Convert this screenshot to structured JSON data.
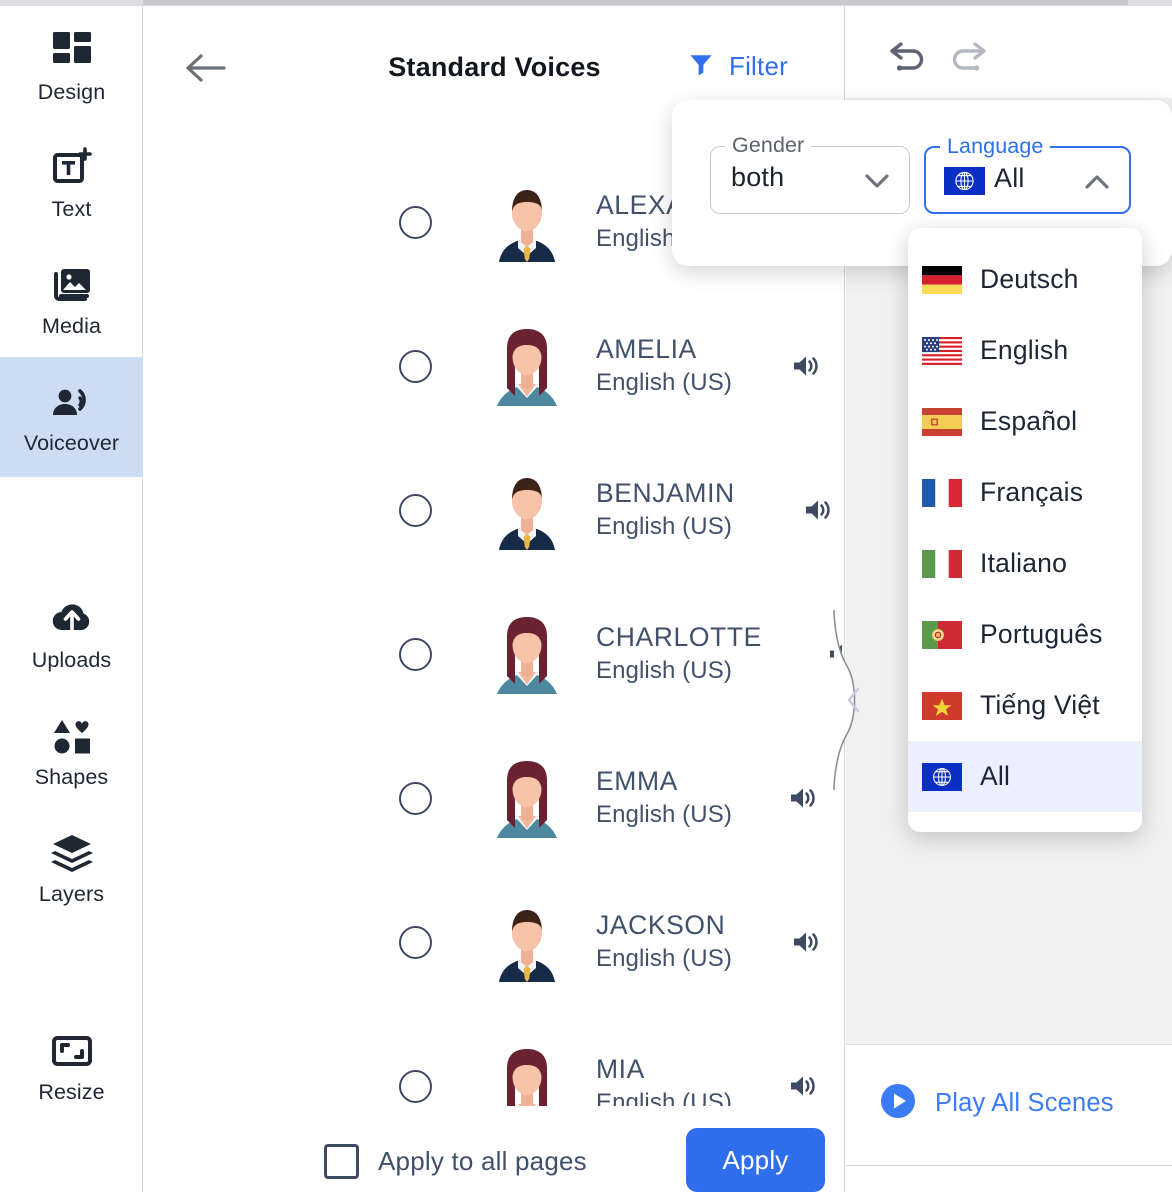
{
  "sidebar": {
    "items": [
      {
        "label": "Design",
        "icon": "grid-icon",
        "active": false
      },
      {
        "label": "Text",
        "icon": "text-add-icon",
        "active": false
      },
      {
        "label": "Media",
        "icon": "media-icon",
        "active": false
      },
      {
        "label": "Voiceover",
        "icon": "voiceover-icon",
        "active": true
      },
      {
        "label": "Uploads",
        "icon": "cloud-upload-icon",
        "active": false
      },
      {
        "label": "Shapes",
        "icon": "shapes-icon",
        "active": false
      },
      {
        "label": "Layers",
        "icon": "layers-icon",
        "active": false
      },
      {
        "label": "Resize",
        "icon": "resize-icon",
        "active": false
      }
    ]
  },
  "panel": {
    "title": "Standard Voices",
    "back_icon": "back-arrow-icon",
    "filter_label": "Filter",
    "filter_icon": "funnel-icon"
  },
  "voices": [
    {
      "name": "ALEXANDER",
      "language": "English (US)",
      "gender": "male",
      "selected": false,
      "has_preview": false
    },
    {
      "name": "AMELIA",
      "language": "English (US)",
      "gender": "female",
      "selected": false,
      "has_preview": true
    },
    {
      "name": "BENJAMIN",
      "language": "English (US)",
      "gender": "male",
      "selected": false,
      "has_preview": true
    },
    {
      "name": "CHARLOTTE",
      "language": "English (US)",
      "gender": "female",
      "selected": false,
      "has_preview": true
    },
    {
      "name": "EMMA",
      "language": "English (US)",
      "gender": "female",
      "selected": false,
      "has_preview": true
    },
    {
      "name": "JACKSON",
      "language": "English (US)",
      "gender": "male",
      "selected": false,
      "has_preview": true
    },
    {
      "name": "MIA",
      "language": "English (US)",
      "gender": "female",
      "selected": false,
      "has_preview": true
    }
  ],
  "footer": {
    "checkbox_label": "Apply to all pages",
    "checkbox_checked": false,
    "apply_label": "Apply"
  },
  "filter_popup": {
    "gender": {
      "legend": "Gender",
      "value": "both",
      "caret": "chevron-down-icon"
    },
    "language": {
      "legend": "Language",
      "value": "All",
      "flag": "globe-flag-icon",
      "caret": "chevron-up-icon"
    }
  },
  "language_menu": {
    "items": [
      {
        "label": "Deutsch",
        "flag": "flag-de",
        "selected": false
      },
      {
        "label": "English",
        "flag": "flag-us",
        "selected": false
      },
      {
        "label": "Español",
        "flag": "flag-es",
        "selected": false
      },
      {
        "label": "Français",
        "flag": "flag-fr",
        "selected": false
      },
      {
        "label": "Italiano",
        "flag": "flag-it",
        "selected": false
      },
      {
        "label": "Português",
        "flag": "flag-pt",
        "selected": false
      },
      {
        "label": "Tiếng Việt",
        "flag": "flag-vn",
        "selected": false
      },
      {
        "label": "All",
        "flag": "globe-flag-icon",
        "selected": true
      }
    ]
  },
  "right_panel": {
    "undo_icon": "undo-icon",
    "redo_icon": "redo-icon",
    "play_all_label": "Play All Scenes",
    "play_icon": "play-circle-icon",
    "collapse_icon": "chevron-left-icon"
  },
  "colors": {
    "accent_blue": "#2f6fed",
    "link_blue": "#3b7bf4",
    "text_slate": "#41506b",
    "sidebar_active": "#ccddf3",
    "menu_selected": "#eaf0fe",
    "panel_gray": "#f1f1f1"
  }
}
